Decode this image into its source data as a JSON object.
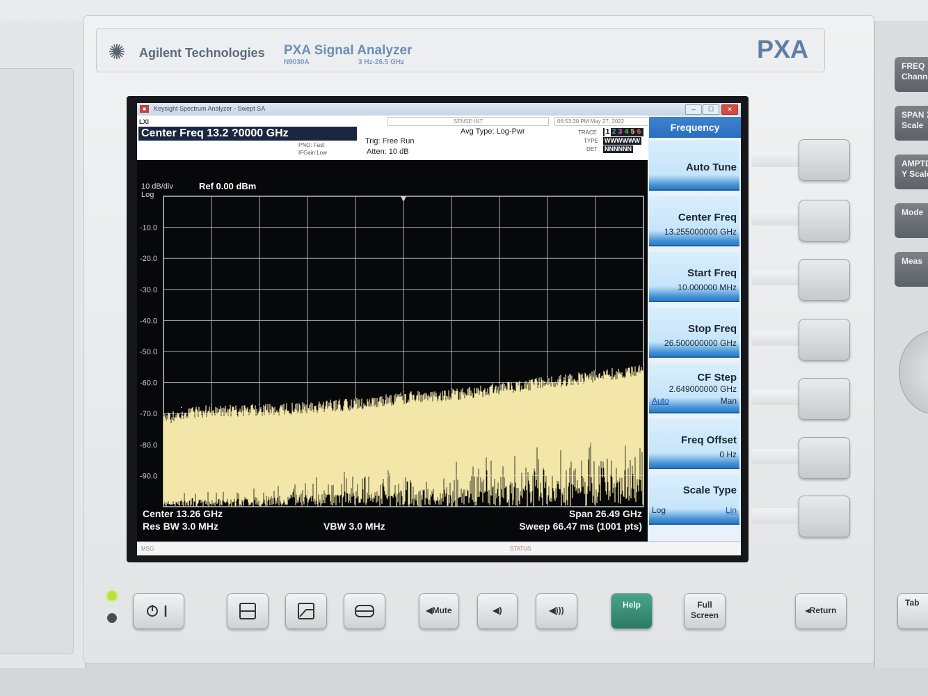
{
  "front_panel": {
    "brand": "Agilent Technologies",
    "model_name": "PXA Signal Analyzer",
    "model_number": "N9030A",
    "freq_range": "3 Hz-26.5 GHz",
    "logo": "PXA"
  },
  "window": {
    "title": "Keysight Spectrum Analyzer - Swept SA",
    "minimize": "–",
    "restore": "☐",
    "close": "✕"
  },
  "header": {
    "ixi": "LXI",
    "center_freq": "Center Freq 13.2 ?0000 GHz",
    "sense": "SENSE:INT",
    "datetime": "06:53:30 PM May 27, 2022",
    "pno": "PNO: Fast",
    "if_gain": "IFGain:Low",
    "trig": "Trig: Free Run",
    "atten": "Atten: 10 dB",
    "avg_type": "Avg Type: Log-Pwr",
    "trace_label": "TRACE",
    "type_label": "TYPE",
    "det_label": "DET",
    "trace_numbers": [
      "1",
      "2",
      "3",
      "4",
      "5",
      "6"
    ],
    "type_row": "WWWWWW",
    "det_row": "NNNNNN"
  },
  "plot": {
    "scale": "10 dB/div",
    "scale_type": "Log",
    "ref_level": "Ref 0.00 dBm",
    "y_ticks": [
      "-10.0",
      "-20.0",
      "-30.0",
      "-40.0",
      "-50.0",
      "-60.0",
      "-70.0",
      "-80.0",
      "-90.0"
    ],
    "center": "Center 13.26 GHz",
    "res_bw": "Res BW 3.0 MHz",
    "vbw": "VBW 3.0 MHz",
    "span": "Span 26.49 GHz",
    "sweep": "Sweep  66.47 ms (1001 pts)",
    "trace_color": "#f2e6a8"
  },
  "chart_data": {
    "type": "line",
    "ylabel": "",
    "ylim": [
      -100,
      0
    ],
    "xlim": [
      10,
      26500
    ],
    "x_units": "MHz",
    "grid": true,
    "series": [
      {
        "x": [
          10,
          1000,
          2650,
          5300,
          7950,
          10600,
          13250,
          15900,
          18550,
          21200,
          23850,
          26500
        ],
        "values": [
          -70,
          -68,
          -67,
          -67,
          -66,
          -65,
          -63,
          -62,
          -60,
          -58,
          -56,
          -54
        ]
      }
    ]
  },
  "status_bar": {
    "msg": "MSG",
    "status": "STATUS"
  },
  "softkeys": {
    "menu_title": "Frequency",
    "auto_tune": "Auto Tune",
    "center_freq": {
      "label": "Center Freq",
      "value": "13.255000000 GHz"
    },
    "start_freq": {
      "label": "Start Freq",
      "value": "10.000000 MHz"
    },
    "stop_freq": {
      "label": "Stop Freq",
      "value": "26.500000000 GHz"
    },
    "cf_step": {
      "label": "CF Step",
      "value": "2.649000000 GHz",
      "auto": "Auto",
      "man": "Man"
    },
    "freq_offset": {
      "label": "Freq Offset",
      "value": "0 Hz"
    },
    "scale_type": {
      "label": "Scale Type",
      "log": "Log",
      "lin": "Lin"
    }
  },
  "right_keys": [
    "FREQ Channel",
    "SPAN X Scale",
    "AMPTD Y Scale",
    "Mode",
    "Meas"
  ],
  "bottom_buttons": {
    "mute": "Mute",
    "help": "Help",
    "full_screen": "Full Screen",
    "return": "Return",
    "tab": "Tab"
  },
  "colors": {
    "accent": "#2a6fc0",
    "trace": "#f2e6a8",
    "help_button": "#2b7a62"
  }
}
